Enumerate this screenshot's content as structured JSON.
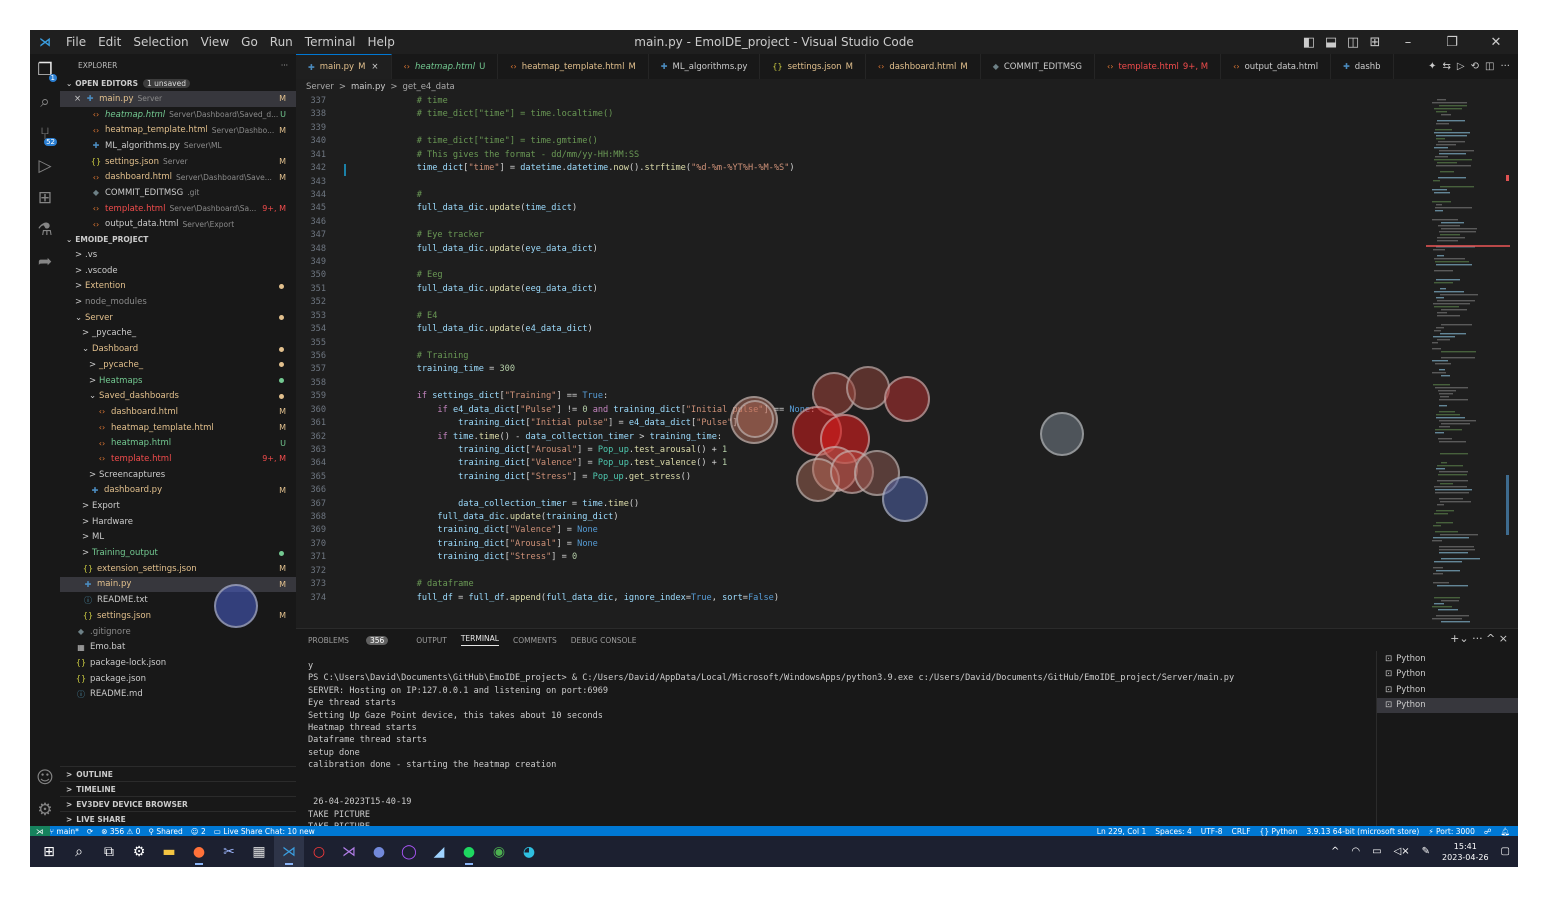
{
  "window": {
    "title": "main.py - EmoIDE_project - Visual Studio Code",
    "menu": [
      "File",
      "Edit",
      "Selection",
      "View",
      "Go",
      "Run",
      "Terminal",
      "Help"
    ]
  },
  "activity_bar": {
    "scm_badge": "1",
    "source_badge": "52"
  },
  "sidebar": {
    "header": "EXPLORER",
    "header_actions": "···",
    "open_editors": {
      "label": "OPEN EDITORS",
      "badge": "1 unsaved",
      "items": [
        {
          "prefix": "×",
          "name": "main.py",
          "path": "Server",
          "status": "M"
        },
        {
          "name": "heatmap.html",
          "path": "Server\\Dashboard\\Saved_d...",
          "status": "U"
        },
        {
          "name": "heatmap_template.html",
          "path": "Server\\Dashbo...",
          "status": "M"
        },
        {
          "name": "ML_algorithms.py",
          "path": "Server\\ML",
          "status": ""
        },
        {
          "name": "settings.json",
          "path": "Server",
          "status": "M"
        },
        {
          "name": "dashboard.html",
          "path": "Server\\Dashboard\\Save...",
          "status": "M"
        },
        {
          "name": "COMMIT_EDITMSG",
          "path": ".git",
          "status": ""
        },
        {
          "name": "template.html",
          "path": "Server\\Dashboard\\Sa...",
          "status": "9+, M"
        },
        {
          "name": "output_data.html",
          "path": "Server\\Export",
          "status": ""
        }
      ]
    },
    "project": {
      "label": "EMOIDE_PROJECT",
      "items": [
        {
          "chev": ">",
          "name": ".vs",
          "status": ""
        },
        {
          "chev": ">",
          "name": ".vscode",
          "status": ""
        },
        {
          "chev": ">",
          "name": "Extention",
          "status": ""
        },
        {
          "chev": ">",
          "name": "node_modules",
          "status": ""
        },
        {
          "chev": "⌄",
          "name": "Server",
          "status": ""
        },
        {
          "chev": ">",
          "name": "_pycache_",
          "status": ""
        },
        {
          "chev": "⌄",
          "name": "Dashboard",
          "status": ""
        },
        {
          "chev": ">",
          "name": "_pycache_",
          "status": ""
        },
        {
          "chev": ">",
          "name": "Heatmaps",
          "status": ""
        },
        {
          "chev": "⌄",
          "name": "Saved_dashboards",
          "status": ""
        },
        {
          "chev": "",
          "name": "dashboard.html",
          "status": "M"
        },
        {
          "chev": "",
          "name": "heatmap_template.html",
          "status": "M"
        },
        {
          "chev": "",
          "name": "heatmap.html",
          "status": "U"
        },
        {
          "chev": "",
          "name": "template.html",
          "status": "9+, M"
        },
        {
          "chev": ">",
          "name": "Screencaptures",
          "status": ""
        },
        {
          "chev": "",
          "name": "dashboard.py",
          "status": "M"
        },
        {
          "chev": ">",
          "name": "Export",
          "status": ""
        },
        {
          "chev": ">",
          "name": "Hardware",
          "status": ""
        },
        {
          "chev": ">",
          "name": "ML",
          "status": ""
        },
        {
          "chev": ">",
          "name": "Training_output",
          "status": ""
        },
        {
          "chev": "",
          "name": "extension_settings.json",
          "status": "M"
        },
        {
          "chev": "",
          "name": "main.py",
          "status": "M"
        },
        {
          "chev": "",
          "name": "README.txt",
          "status": ""
        },
        {
          "chev": "",
          "name": "settings.json",
          "status": "M"
        },
        {
          "chev": "",
          "name": ".gitignore",
          "status": ""
        },
        {
          "chev": "",
          "name": "Emo.bat",
          "status": ""
        },
        {
          "chev": "",
          "name": "package-lock.json",
          "status": ""
        },
        {
          "chev": "",
          "name": "package.json",
          "status": ""
        },
        {
          "chev": "",
          "name": "README.md",
          "status": ""
        }
      ]
    },
    "bottom_sections": [
      "OUTLINE",
      "TIMELINE",
      "EV3DEV DEVICE BROWSER",
      "LIVE SHARE"
    ]
  },
  "tabs": [
    {
      "name": "main.py",
      "status": "M",
      "close": "×"
    },
    {
      "name": "heatmap.html",
      "status": "U"
    },
    {
      "name": "heatmap_template.html",
      "status": "M"
    },
    {
      "name": "ML_algorithms.py",
      "status": ""
    },
    {
      "name": "settings.json",
      "status": "M"
    },
    {
      "name": "dashboard.html",
      "status": "M"
    },
    {
      "name": "COMMIT_EDITMSG",
      "status": ""
    },
    {
      "name": "template.html",
      "status": "9+, M"
    },
    {
      "name": "output_data.html",
      "status": ""
    },
    {
      "name": "dashb",
      "status": ""
    }
  ],
  "breadcrumb": [
    "Server",
    ">",
    "main.py",
    ">",
    "get_e4_data"
  ],
  "code": {
    "line_numbers": [
      "337",
      "338",
      "339",
      "340",
      "341",
      "342",
      "343",
      "344",
      "345",
      "346",
      "347",
      "348",
      "349",
      "350",
      "351",
      "352",
      "353",
      "354",
      "355",
      "356",
      "357",
      "358",
      "359",
      "360",
      "361",
      "362",
      "363",
      "364",
      "365",
      "366",
      "367",
      "368",
      "369",
      "370",
      "371",
      "372",
      "373",
      "374"
    ],
    "lines": [
      "    # time",
      "    # time_dict[\"time\"] = time.localtime()",
      "",
      "    # time_dict[\"time\"] = time.gmtime()",
      "    # This gives the format - dd/mm/yy-HH:MM:SS",
      "    time_dict[\"time\"] = datetime.datetime.now().strftime(\"%d-%m-%YT%H-%M-%S\")",
      "",
      "    #",
      "    full_data_dic.update(time_dict)",
      "",
      "    # Eye tracker",
      "    full_data_dic.update(eye_data_dict)",
      "",
      "    # Eeg",
      "    full_data_dic.update(eeg_data_dict)",
      "",
      "    # E4",
      "    full_data_dic.update(e4_data_dict)",
      "",
      "    # Training",
      "    training_time = 300",
      "",
      "    if settings_dict[\"Training\"] == True:",
      "        if e4_data_dict[\"Pulse\"] != 0 and training_dict[\"Initial pulse\"] == None:",
      "            training_dict[\"Initial pulse\"] = e4_data_dict[\"Pulse\"]",
      "        if time.time() - data_collection_timer > training_time:",
      "            training_dict[\"Arousal\"] = Pop_up.test_arousal() + 1",
      "            training_dict[\"Valence\"] = Pop_up.test_valence() + 1",
      "            training_dict[\"Stress\"] = Pop_up.get_stress()",
      "",
      "            data_collection_timer = time.time()",
      "        full_data_dic.update(training_dict)",
      "        training_dict[\"Valence\"] = None",
      "        training_dict[\"Arousal\"] = None",
      "        training_dict[\"Stress\"] = 0",
      "",
      "    # dataframe",
      "    full_df = full_df.append(full_data_dic, ignore_index=True, sort=False)"
    ]
  },
  "panel": {
    "tabs": [
      "PROBLEMS",
      "OUTPUT",
      "TERMINAL",
      "COMMENTS",
      "DEBUG CONSOLE"
    ],
    "problems_count": "356",
    "actions": "+⌄ ··· ^ ×",
    "terminal_lines": [
      "y",
      "PS C:\\Users\\David\\Documents\\GitHub\\EmoIDE_project> & C:/Users/David/AppData/Local/Microsoft/WindowsApps/python3.9.exe c:/Users/David/Documents/GitHub/EmoIDE_project/Server/main.py",
      "SERVER: Hosting on IP:127.0.0.1 and listening on port:6969",
      "Eye thread starts",
      "Setting Up Gaze Point device, this takes about 10 seconds",
      "Heatmap thread starts",
      "Dataframe thread starts",
      "setup done",
      "calibration done - starting the heatmap creation",
      "",
      "",
      " 26-04-2023T15-40-19",
      "TAKE PICTURE",
      "TAKE PICTURE",
      "▯"
    ],
    "terminals": [
      "Python",
      "Python",
      "Python",
      "Python"
    ]
  },
  "statusbar": {
    "left": [
      "main*",
      "⟳",
      "⊗ 356 ⚠ 0",
      "Shared",
      "2",
      "Live Share Chat: 10 new"
    ],
    "right": [
      "Ln 229, Col 1",
      "Spaces: 4",
      "UTF-8",
      "CRLF",
      "{} Python",
      "3.9.13 64-bit (microsoft store)",
      "Port: 3000"
    ]
  },
  "taskbar": {
    "time": "15:41",
    "date": "2023-04-26"
  },
  "colors": {
    "accent": "#0078d4",
    "modified": "#e2c08d",
    "untracked": "#73c991",
    "error": "#f14c4c"
  }
}
